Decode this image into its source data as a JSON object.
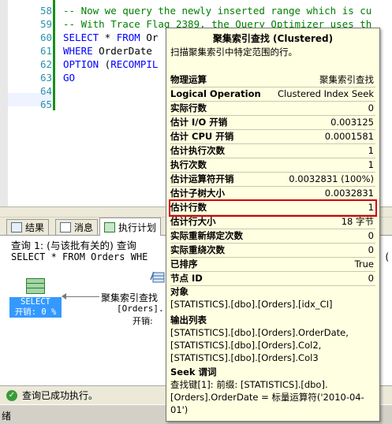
{
  "editor": {
    "lines": [
      {
        "num": "58",
        "parts": [
          {
            "cls": "cmt",
            "text": "-- Now we query the newly inserted range which is cu"
          }
        ]
      },
      {
        "num": "59",
        "parts": [
          {
            "cls": "cmt",
            "text": "-- With Trace Flag 2389, the Query Optimizer uses th"
          }
        ]
      },
      {
        "num": "60",
        "parts": [
          {
            "cls": "kw",
            "text": "SELECT"
          },
          {
            "cls": "plain",
            "text": " * "
          },
          {
            "cls": "kw",
            "text": "FROM"
          },
          {
            "cls": "plain",
            "text": " Or"
          }
        ]
      },
      {
        "num": "61",
        "parts": [
          {
            "cls": "kw",
            "text": "WHERE"
          },
          {
            "cls": "plain",
            "text": " OrderDate"
          }
        ]
      },
      {
        "num": "62",
        "parts": [
          {
            "cls": "kw",
            "text": "OPTION"
          },
          {
            "cls": "plain",
            "text": " ("
          },
          {
            "cls": "kw",
            "text": "RECOMPIL"
          }
        ]
      },
      {
        "num": "63",
        "parts": [
          {
            "cls": "kw",
            "text": "GO"
          }
        ]
      },
      {
        "num": "64",
        "parts": []
      },
      {
        "num": "65",
        "parts": []
      }
    ]
  },
  "tabs": [
    {
      "label": "结果",
      "active": false
    },
    {
      "label": "消息",
      "active": false
    },
    {
      "label": "执行计划",
      "active": true
    }
  ],
  "plan": {
    "query_line": "查询 1: (与该批有关的) 查询",
    "sql_line": "SELECT * FROM Orders WHE",
    "sql_tail": "(",
    "select_node": {
      "label": "SELECT",
      "cost": "开销: 0 %"
    },
    "seek_node": {
      "label": "聚集索引查找",
      "sub1": "[Orders].",
      "sub2": "开销:"
    }
  },
  "status": {
    "text": "查询已成功执行。"
  },
  "bottom": {
    "text": "绪"
  },
  "tooltip": {
    "title": "聚集索引查找 (Clustered)",
    "description": "扫描聚集索引中特定范围的行。",
    "rows": [
      {
        "key": "物理运算",
        "value": "聚集索引查找",
        "highlight": false
      },
      {
        "key": "Logical Operation",
        "value": "Clustered Index Seek",
        "highlight": false
      },
      {
        "key": "实际行数",
        "value": "0",
        "highlight": false
      },
      {
        "key": "估计 I/O 开销",
        "value": "0.003125",
        "highlight": false
      },
      {
        "key": "估计 CPU 开销",
        "value": "0.0001581",
        "highlight": false
      },
      {
        "key": "估计执行次数",
        "value": "1",
        "highlight": false
      },
      {
        "key": "执行次数",
        "value": "1",
        "highlight": false
      },
      {
        "key": "估计运算符开销",
        "value": "0.0032831 (100%)",
        "highlight": false
      },
      {
        "key": "估计子树大小",
        "value": "0.0032831",
        "highlight": false
      },
      {
        "key": "估计行数",
        "value": "1",
        "highlight": true
      },
      {
        "key": "估计行大小",
        "value": "18 字节",
        "highlight": false
      },
      {
        "key": "实际重新绑定次数",
        "value": "0",
        "highlight": false
      },
      {
        "key": "实际重绕次数",
        "value": "0",
        "highlight": false
      },
      {
        "key": "已排序",
        "value": "True",
        "highlight": false
      },
      {
        "key": "节点 ID",
        "value": "0",
        "highlight": false
      }
    ],
    "object_heading": "对象",
    "object_value": "[STATISTICS].[dbo].[Orders].[idx_CI]",
    "output_heading": "输出列表",
    "output_value": "[STATISTICS].[dbo].[Orders].OrderDate,\n[STATISTICS].[dbo].[Orders].Col2,\n[STATISTICS].[dbo].[Orders].Col3",
    "seek_heading": "Seek 谓词",
    "seek_value": "查找键[1]: 前缀: [STATISTICS].[dbo].\n[Orders].OrderDate = 标量运算符('2010-04-\n01')"
  },
  "colors": {
    "highlight_border": "#d40000",
    "comment": "#008000",
    "keyword": "#0000ff",
    "line_number": "#2b91af"
  }
}
